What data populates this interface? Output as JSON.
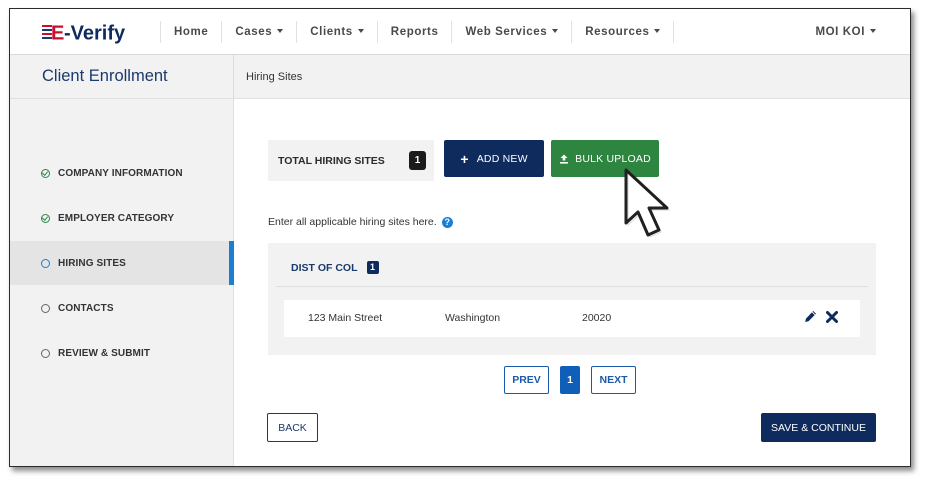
{
  "app": {
    "logo_text": "E-Verify",
    "colors": {
      "navy": "#0f2a5c",
      "brand_red": "#c8102e",
      "green": "#2e8540",
      "blue": "#1a7fd1"
    }
  },
  "nav": {
    "items": [
      {
        "label": "Home",
        "dropdown": false
      },
      {
        "label": "Cases",
        "dropdown": true
      },
      {
        "label": "Clients",
        "dropdown": true
      },
      {
        "label": "Reports",
        "dropdown": false
      },
      {
        "label": "Web Services",
        "dropdown": true
      },
      {
        "label": "Resources",
        "dropdown": true
      }
    ],
    "user": "MOI KOI"
  },
  "header": {
    "title": "Client Enrollment",
    "section": "Hiring Sites"
  },
  "sidebar": {
    "items": [
      {
        "label": "COMPANY INFORMATION",
        "status": "complete",
        "icon": "check-circle-icon"
      },
      {
        "label": "EMPLOYER CATEGORY",
        "status": "complete",
        "icon": "check-circle-icon"
      },
      {
        "label": "HIRING SITES",
        "status": "current",
        "icon": "circle-icon"
      },
      {
        "label": "CONTACTS",
        "status": "pending",
        "icon": "circle-icon"
      },
      {
        "label": "REVIEW & SUBMIT",
        "status": "pending",
        "icon": "circle-icon"
      }
    ]
  },
  "main": {
    "total_label": "TOTAL HIRING SITES",
    "total_count": "1",
    "add_new_label": "ADD NEW",
    "bulk_upload_label": "BULK UPLOAD",
    "hint": "Enter all applicable hiring sites here.",
    "group": {
      "name": "DIST OF COL",
      "count": "1",
      "rows": [
        {
          "address": "123 Main Street",
          "city": "Washington",
          "zip": "20020"
        }
      ]
    },
    "pager": {
      "prev": "PREV",
      "current": "1",
      "next": "NEXT"
    },
    "back_label": "BACK",
    "save_label": "SAVE & CONTINUE"
  }
}
